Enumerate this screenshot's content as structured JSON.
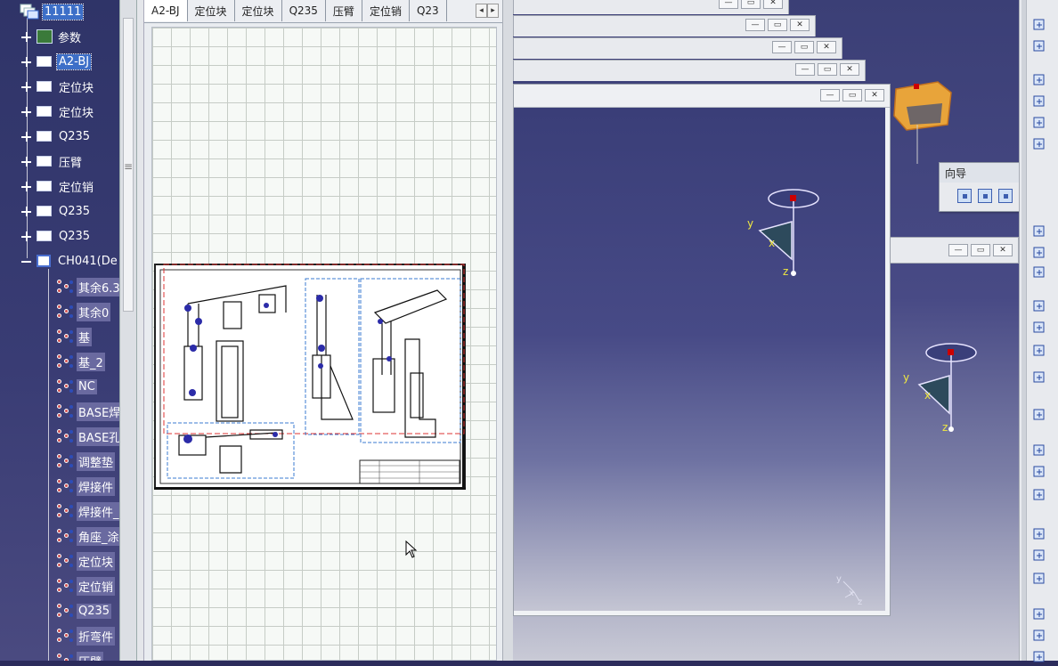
{
  "tree": {
    "root_label": "11111",
    "nodes": [
      {
        "label": "参数",
        "type": "params",
        "expand": "plus"
      },
      {
        "label": "A2-BJ",
        "type": "sheet",
        "expand": "plus",
        "selected": true
      },
      {
        "label": "定位块",
        "type": "sheet",
        "expand": "plus"
      },
      {
        "label": "定位块",
        "type": "sheet",
        "expand": "plus"
      },
      {
        "label": "Q235",
        "type": "sheet",
        "expand": "plus"
      },
      {
        "label": "压臂",
        "type": "sheet",
        "expand": "plus"
      },
      {
        "label": "定位销",
        "type": "sheet",
        "expand": "plus"
      },
      {
        "label": "Q235",
        "type": "sheet",
        "expand": "plus"
      },
      {
        "label": "Q235",
        "type": "sheet",
        "expand": "plus"
      },
      {
        "label": "CH041(De",
        "type": "product",
        "expand": "minus"
      }
    ],
    "children": [
      {
        "label": "其余6.3"
      },
      {
        "label": "其余0"
      },
      {
        "label": "基"
      },
      {
        "label": "基_2"
      },
      {
        "label": "NC"
      },
      {
        "label": "BASE焊"
      },
      {
        "label": "BASE孔"
      },
      {
        "label": "调整垫"
      },
      {
        "label": "焊接件"
      },
      {
        "label": "焊接件_"
      },
      {
        "label": "角座_涂"
      },
      {
        "label": "定位块"
      },
      {
        "label": "定位销"
      },
      {
        "label": "Q235"
      },
      {
        "label": "折弯件"
      },
      {
        "label": "压臂"
      }
    ]
  },
  "sheet_tabs": [
    "A2-BJ",
    "定位块",
    "定位块",
    "Q235",
    "压臂",
    "定位销",
    "Q23"
  ],
  "tab_scroll": {
    "left": "◂",
    "right": "▸"
  },
  "window_buttons": {
    "min": "—",
    "restore": "▭",
    "close": "✕"
  },
  "wizard": {
    "title": "向导",
    "close": "✕"
  },
  "axes": {
    "x": "x",
    "y": "y",
    "z": "z"
  },
  "toolbar_icons": [
    "select-arrow-icon",
    "rotate-icon",
    "view-front-icon",
    "view-iso-icon",
    "color-icon",
    "render-icon",
    "frame-icon",
    "grid-icon",
    "constraint-icon",
    "dimension-icon",
    "annotation-icon",
    "measure-icon",
    "text-frame-icon",
    "balloon-icon",
    "text-icon",
    "roughness-icon",
    "table-icon",
    "axis-icon",
    "weld-icon",
    "arrow-icon",
    "point-icon",
    "line-icon",
    "circle-icon"
  ],
  "colors": {
    "tree_bg": "#2f3468",
    "selection": "#3d6fc8",
    "viewer_top": "#3b3f76",
    "grid_line": "#c6ccc6"
  }
}
